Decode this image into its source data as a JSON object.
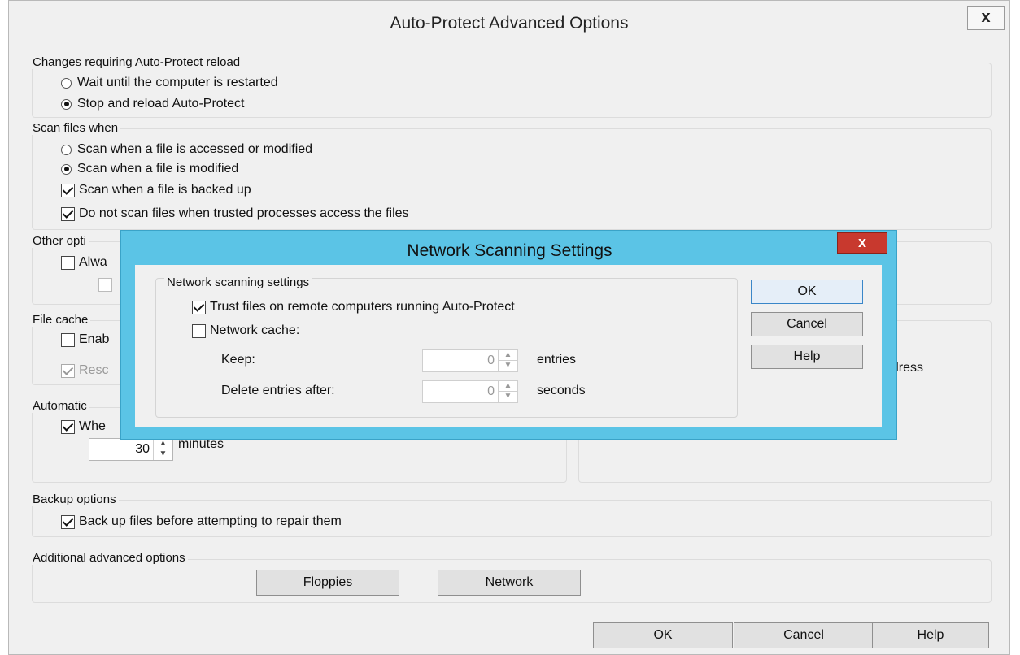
{
  "window": {
    "title": "Auto-Protect Advanced Options",
    "close_glyph": "x"
  },
  "reload_group": {
    "label": "Changes requiring Auto-Protect reload",
    "options": [
      {
        "label": "Wait until the computer is restarted",
        "selected": false
      },
      {
        "label": "Stop and reload Auto-Protect",
        "selected": true
      }
    ]
  },
  "scan_group": {
    "label": "Scan files when",
    "radios": [
      {
        "label": "Scan when a file is accessed or modified",
        "selected": false
      },
      {
        "label": "Scan when a file is modified",
        "selected": true
      }
    ],
    "checks": [
      {
        "label": "Scan when a file is backed up",
        "checked": true
      },
      {
        "label": "Do not scan files when trusted processes access the files",
        "checked": true
      }
    ]
  },
  "other_group": {
    "label": "Other opti",
    "check_label": "Alwa"
  },
  "file_cache_group": {
    "label": "File cache",
    "enable_label": "Enab",
    "rescan_label": "Resc"
  },
  "automatic_group": {
    "label": "Automatic",
    "when_label": "Whe",
    "minutes_value": "30",
    "minutes_unit": "minutes"
  },
  "right_fragment": {
    "address_text": "ddress"
  },
  "backup_group": {
    "label": "Backup options",
    "check_label": "Back up files before attempting to repair them",
    "checked": true
  },
  "advanced_group": {
    "label": "Additional advanced options",
    "floppies_button": "Floppies",
    "network_button": "Network"
  },
  "footer": {
    "ok_button": "OK",
    "cancel_button": "Cancel",
    "help_button": "Help"
  },
  "network_dialog": {
    "title": "Network Scanning Settings",
    "close_glyph": "x",
    "group_label": "Network scanning settings",
    "trust_label": "Trust files on remote computers running Auto-Protect",
    "trust_checked": true,
    "cache_label": "Network cache:",
    "cache_checked": false,
    "keep_label": "Keep:",
    "keep_value": "0",
    "keep_unit": "entries",
    "delete_label": "Delete entries after:",
    "delete_value": "0",
    "delete_unit": "seconds",
    "ok_button": "OK",
    "cancel_button": "Cancel",
    "help_button": "Help"
  }
}
